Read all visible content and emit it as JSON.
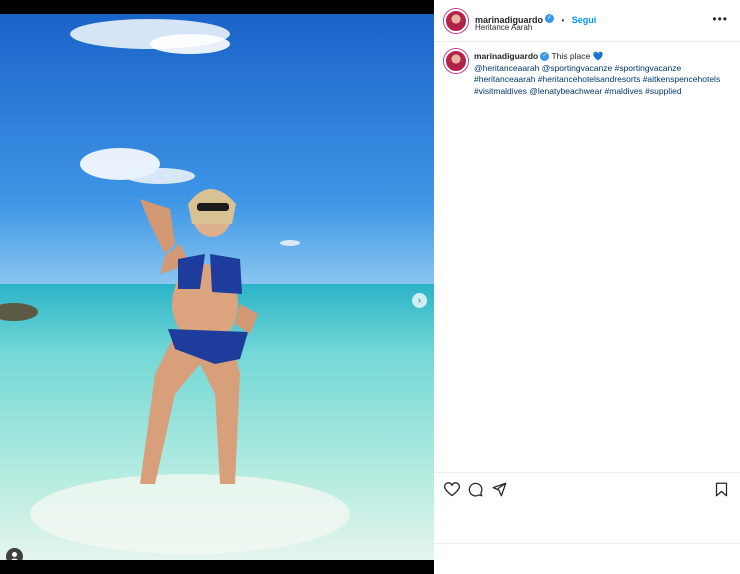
{
  "post": {
    "username": "marinadiguardo",
    "separator": "•",
    "follow_label": "Segui",
    "location": "Heritance Aarah",
    "menu_icon": "more-options-icon"
  },
  "caption": {
    "username": "marinadiguardo",
    "text": "This place",
    "heart": "💙",
    "line1": "@heritanceaarah @sportingvacanze #sportingvacanze",
    "line2": "#heritanceaarah #heritancehotelsandresorts #aitkenspencehotels",
    "line3": "#visitmaldives @lenatybeachwear #maldives #supplied"
  },
  "actions": {
    "like": "heart-icon",
    "comment": "comment-icon",
    "share": "share-icon",
    "save": "bookmark-icon"
  },
  "colors": {
    "accent": "#0095f6",
    "verified": "#3897f0",
    "sky": "#1a6fd0",
    "sea": "#6fd6d8"
  }
}
